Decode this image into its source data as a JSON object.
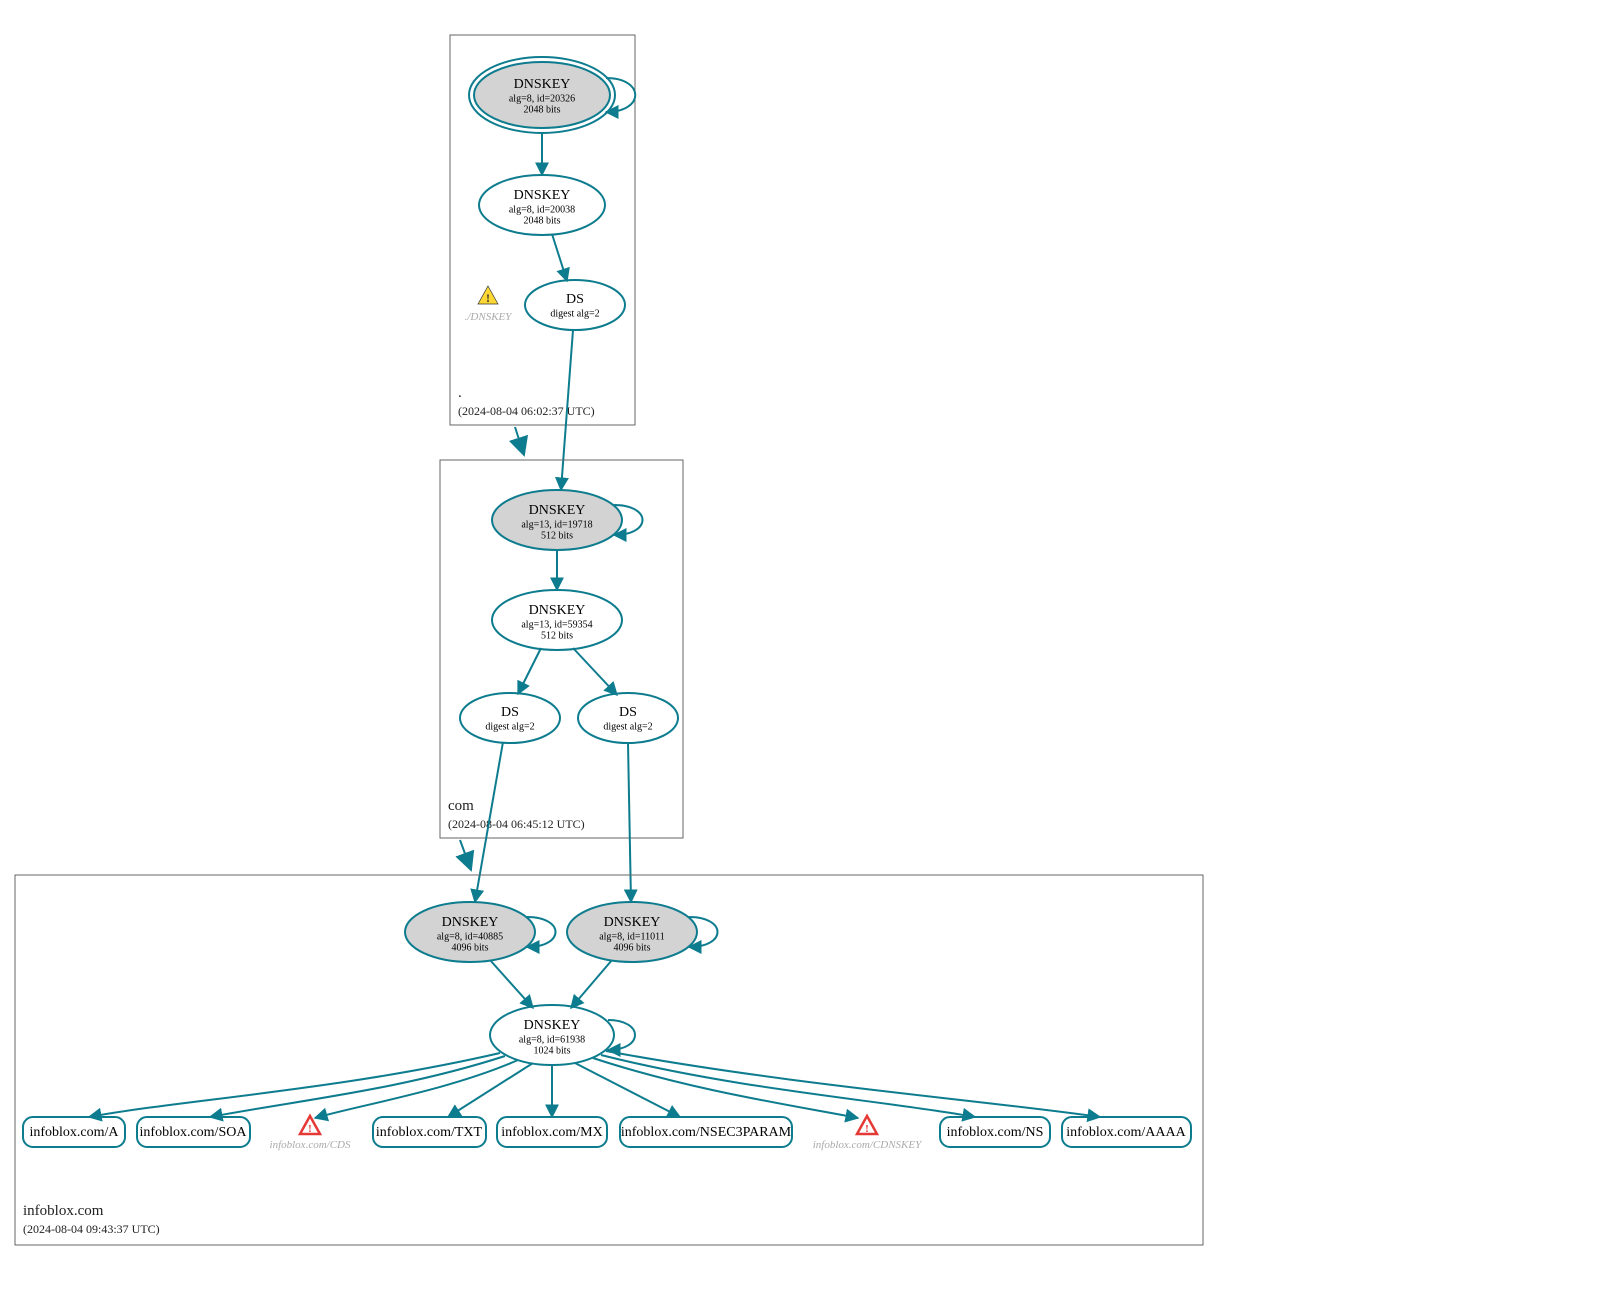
{
  "zones": {
    "root": {
      "name": ".",
      "timestamp": "(2024-08-04 06:02:37 UTC)",
      "dnskey_ksk": {
        "title": "DNSKEY",
        "line1": "alg=8, id=20326",
        "line2": "2048 bits"
      },
      "dnskey_zsk": {
        "title": "DNSKEY",
        "line1": "alg=8, id=20038",
        "line2": "2048 bits"
      },
      "ds": {
        "title": "DS",
        "line1": "digest alg=2"
      },
      "warn_label": "./DNSKEY"
    },
    "com": {
      "name": "com",
      "timestamp": "(2024-08-04 06:45:12 UTC)",
      "dnskey_ksk": {
        "title": "DNSKEY",
        "line1": "alg=13, id=19718",
        "line2": "512 bits"
      },
      "dnskey_zsk": {
        "title": "DNSKEY",
        "line1": "alg=13, id=59354",
        "line2": "512 bits"
      },
      "ds1": {
        "title": "DS",
        "line1": "digest alg=2"
      },
      "ds2": {
        "title": "DS",
        "line1": "digest alg=2"
      }
    },
    "infoblox": {
      "name": "infoblox.com",
      "timestamp": "(2024-08-04 09:43:37 UTC)",
      "dnskey_ksk1": {
        "title": "DNSKEY",
        "line1": "alg=8, id=40885",
        "line2": "4096 bits"
      },
      "dnskey_ksk2": {
        "title": "DNSKEY",
        "line1": "alg=8, id=11011",
        "line2": "4096 bits"
      },
      "dnskey_zsk": {
        "title": "DNSKEY",
        "line1": "alg=8, id=61938",
        "line2": "1024 bits"
      },
      "rr_a": "infoblox.com/A",
      "rr_soa": "infoblox.com/SOA",
      "rr_txt": "infoblox.com/TXT",
      "rr_mx": "infoblox.com/MX",
      "rr_nsec": "infoblox.com/NSEC3PARAM",
      "rr_ns": "infoblox.com/NS",
      "rr_aaaa": "infoblox.com/AAAA",
      "warn_cds": "infoblox.com/CDS",
      "warn_cdnskey": "infoblox.com/CDNSKEY"
    }
  }
}
